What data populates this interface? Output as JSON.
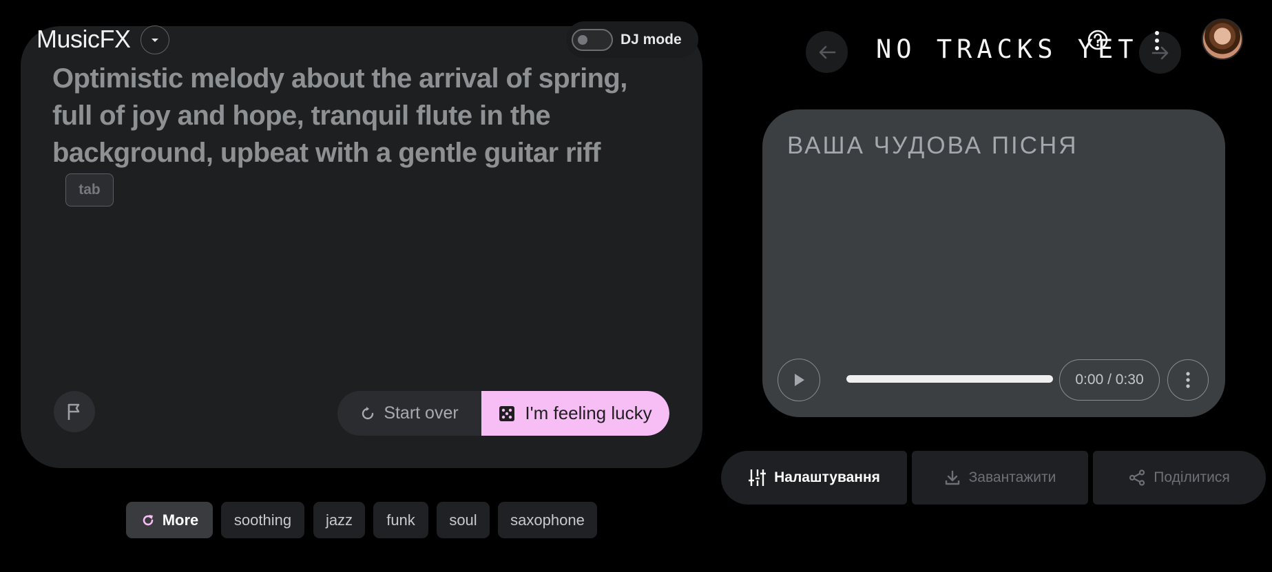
{
  "app": {
    "brand": "MusicFX",
    "dj_mode_label": "DJ mode",
    "dj_mode_on": false
  },
  "prompt": {
    "text": "Optimistic melody about the arrival of spring, full of joy and hope, tranquil flute in the background, upbeat with a gentle guitar riff",
    "tab_hint": "tab",
    "start_over_label": "Start over",
    "lucky_label": "I'm feeling lucky"
  },
  "chips": {
    "more_label": "More",
    "items": [
      "soothing",
      "jazz",
      "funk",
      "soul",
      "saxophone"
    ]
  },
  "tracks": {
    "title": "NO TRACKS YET"
  },
  "player": {
    "song_title": "ВАША ЧУДОВА ПІСНЯ",
    "time": "0:00 / 0:30",
    "progress_fraction": 1.0
  },
  "actions": {
    "settings_label": "Налаштування",
    "download_label": "Завантажити",
    "share_label": "Поділитися"
  },
  "colors": {
    "lucky_bg": "#f7bdf5",
    "more_icon": "#f7bdf5"
  }
}
